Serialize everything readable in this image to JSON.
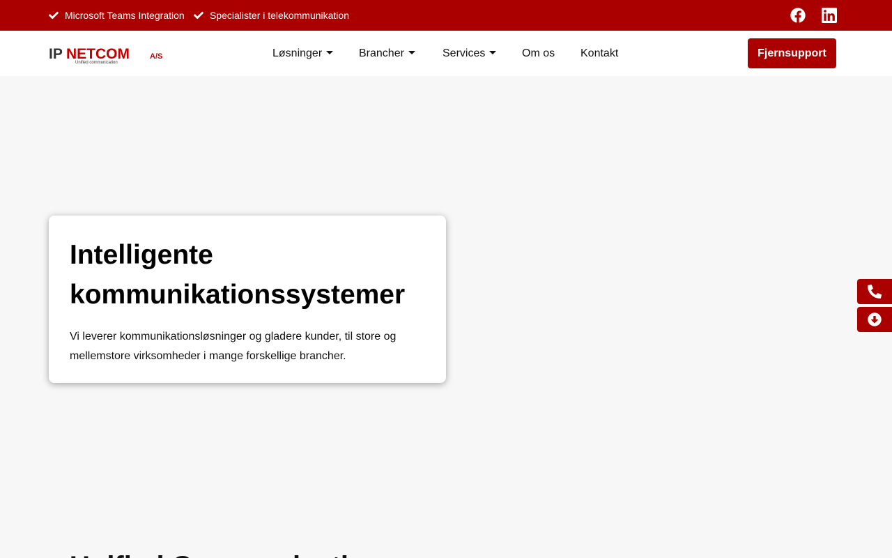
{
  "topbar": {
    "usp_1": "Microsoft Teams Integration",
    "usp_2": "Specialister i telekommunikation",
    "icons": [
      "check-icon",
      "facebook-icon",
      "linkedin-icon"
    ]
  },
  "logo": {
    "brand": "IPNETCOM A/S",
    "tagline": "Unified communication"
  },
  "nav": {
    "items": [
      {
        "label": "Løsninger",
        "has_dropdown": true
      },
      {
        "label": "Brancher",
        "has_dropdown": true
      },
      {
        "label": "Services",
        "has_dropdown": true
      },
      {
        "label": "Om os",
        "has_dropdown": false
      },
      {
        "label": "Kontakt",
        "has_dropdown": false
      }
    ],
    "cta_label": "Fjernsupport"
  },
  "hero": {
    "title": "Intelligente kommunikationssystemer",
    "text": "Vi leverer kommunikationsløsninger og gladere kunder, til store og mellemstore virksomheder i mange forskellige brancher."
  },
  "side_buttons": [
    "phone-icon",
    "download-icon"
  ],
  "next_section": {
    "heading": "Unified Communication"
  },
  "colors": {
    "brand_red": "#ab0000",
    "background": "#f7f7f7",
    "white": "#ffffff"
  }
}
